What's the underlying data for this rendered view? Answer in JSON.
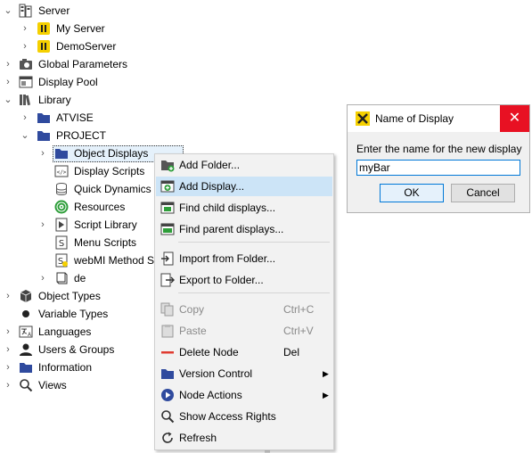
{
  "tree": {
    "server": "Server",
    "my_server": "My Server",
    "demo_server": "DemoServer",
    "global_parameters": "Global Parameters",
    "display_pool": "Display Pool",
    "library": "Library",
    "atvise": "ATVISE",
    "project": "PROJECT",
    "object_displays": "Object Displays",
    "display_scripts": "Display Scripts",
    "quick_dynamics": "Quick Dynamics",
    "resources": "Resources",
    "script_library": "Script Library",
    "menu_scripts": "Menu Scripts",
    "webmi_method": "webMI Method Sc",
    "de": "de",
    "object_types": "Object Types",
    "variable_types": "Variable Types",
    "languages": "Languages",
    "users_groups": "Users & Groups",
    "information": "Information",
    "views": "Views"
  },
  "context_menu": {
    "add_folder": "Add Folder...",
    "add_display": "Add Display...",
    "find_child": "Find child displays...",
    "find_parent": "Find parent displays...",
    "import_folder": "Import from Folder...",
    "export_folder": "Export to Folder...",
    "copy": "Copy",
    "copy_key": "Ctrl+C",
    "paste": "Paste",
    "paste_key": "Ctrl+V",
    "delete_node": "Delete Node",
    "delete_key": "Del",
    "version_control": "Version Control",
    "node_actions": "Node Actions",
    "show_access": "Show Access Rights",
    "refresh": "Refresh"
  },
  "dialog": {
    "title": "Name of Display",
    "prompt": "Enter the name for the new display",
    "input_value": "myBar",
    "ok": "OK",
    "cancel": "Cancel"
  },
  "colors": {
    "accent_blue": "#2f4a9e",
    "hover": "#cce4f7",
    "close_red": "#e81123",
    "delete_red": "#e03c31",
    "server_yellow": "#f5d000"
  }
}
